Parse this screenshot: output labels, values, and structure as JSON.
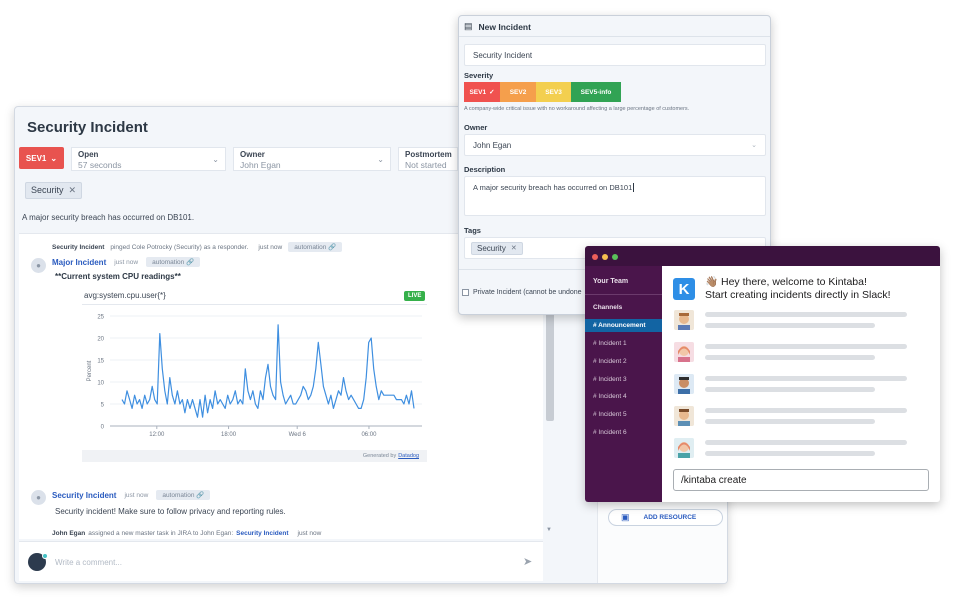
{
  "main": {
    "title": "Security Incident",
    "severity": "SEV1",
    "fields": [
      {
        "label": "Open",
        "value": "57 seconds"
      },
      {
        "label": "Owner",
        "value": "John Egan"
      },
      {
        "label": "Postmortem",
        "value": "Not started"
      }
    ],
    "tag": "Security",
    "description": "A major security breach has occurred on DB101.",
    "feed": {
      "ping": {
        "author": "Security Incident",
        "text": "pinged Cole Potrocky (Security) as a responder.",
        "time": "just now",
        "pill": "automation"
      },
      "post1": {
        "author": "Major Incident",
        "time": "just now",
        "pill": "automation",
        "heading": "**Current system CPU readings**",
        "chart_title": "avg:system.cpu.user{*}",
        "live": "LIVE",
        "generated": "Generated by",
        "generated_link": "Datadog"
      },
      "post2": {
        "author": "Security Incident",
        "time": "just now",
        "pill": "automation",
        "text": "Security incident!  Make sure to follow privacy and reporting rules."
      },
      "footer": {
        "author": "John Egan",
        "text": "assigned a new master task in JIRA to John Egan:",
        "link": "Security Incident",
        "time": "just now"
      }
    },
    "comment_placeholder": "Write a comment...",
    "add_resource": "ADD RESOURCE"
  },
  "chart_data": {
    "type": "line",
    "title": "avg:system.cpu.user{*}",
    "xlabel": "",
    "ylabel": "Percent",
    "ylim": [
      0,
      25
    ],
    "yticks": [
      0,
      5,
      10,
      15,
      20,
      25
    ],
    "xtick_labels": [
      "12:00",
      "18:00",
      "Wed 6",
      "06:00"
    ],
    "xtick_positions": [
      0.15,
      0.38,
      0.6,
      0.83
    ],
    "series": [
      {
        "values": [
          6,
          5,
          8,
          6,
          4,
          7,
          5,
          6,
          4,
          7,
          5,
          6,
          9,
          6,
          5,
          21,
          13,
          8,
          5,
          11,
          7,
          5,
          8,
          5,
          6,
          3,
          6,
          4,
          6,
          4,
          2,
          6,
          2,
          7,
          3,
          6,
          4,
          8,
          5,
          6,
          5,
          4,
          7,
          5,
          6,
          8,
          5,
          6,
          5,
          13,
          8,
          6,
          8,
          5,
          4,
          8,
          6,
          11,
          14,
          9,
          7,
          6,
          23,
          10,
          7,
          5,
          6,
          7,
          5,
          5,
          6,
          7,
          9,
          8,
          6,
          7,
          9,
          13,
          19,
          14,
          9,
          7,
          5,
          7,
          4,
          6,
          8,
          7,
          11,
          8,
          6,
          7,
          6,
          5,
          4,
          4,
          6,
          11,
          19,
          20,
          13,
          9,
          6,
          8,
          7,
          7,
          7,
          7,
          7,
          6,
          6,
          6,
          5,
          7,
          5,
          8,
          4
        ]
      }
    ]
  },
  "modal": {
    "title": "New Incident",
    "name_value": "Security Incident",
    "severity_label": "Severity",
    "severities": [
      "SEV1",
      "SEV2",
      "SEV3",
      "SEV5-info"
    ],
    "severity_hint": "A company-wide critical issue with no workaround affecting a large percentage of customers.",
    "owner_label": "Owner",
    "owner_value": "John Egan",
    "description_label": "Description",
    "description_value": "A major security breach has occurred on DB101",
    "tags_label": "Tags",
    "tag": "Security",
    "private_label": "Private Incident (cannot be undone"
  },
  "slack": {
    "team": "Your Team",
    "channels_label": "Channels",
    "channels": [
      "# Announcement",
      "# Incident 1",
      "# Incident 2",
      "# Incident 3",
      "# Incident 4",
      "# Incident 5",
      "# Incident 6"
    ],
    "welcome_line1": "👋🏽 Hey there, welcome to Kintaba!",
    "welcome_line2": "Start creating incidents directly in Slack!",
    "logo_letter": "K",
    "command": "/kintaba create"
  },
  "colors": {
    "sev1": "#f0524f",
    "sev2": "#f59f4c",
    "sev3": "#f3cf4f",
    "sev5": "#31a354",
    "slack_side": "#4a154b",
    "channel_active": "#1264a3",
    "link": "#2a5bbf"
  }
}
